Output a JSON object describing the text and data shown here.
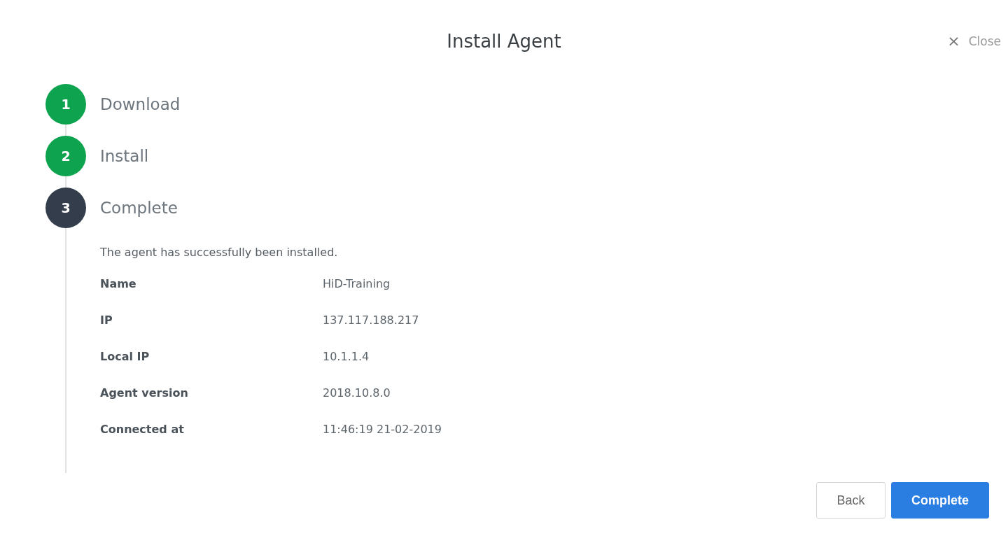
{
  "dialog": {
    "title": "Install Agent",
    "close": {
      "icon": "×",
      "label": "Close"
    }
  },
  "steps": [
    {
      "number": "1",
      "label": "Download",
      "completed": true,
      "selected": false
    },
    {
      "number": "2",
      "label": "Install",
      "completed": true,
      "selected": false
    },
    {
      "number": "3",
      "label": "Complete",
      "completed": false,
      "selected": true,
      "message": "The agent has successfully been installed.",
      "details": [
        {
          "label": "Name",
          "value": "HiD-Training"
        },
        {
          "label": "IP",
          "value": "137.117.188.217"
        },
        {
          "label": "Local IP",
          "value": "10.1.1.4"
        },
        {
          "label": "Agent version",
          "value": "2018.10.8.0"
        },
        {
          "label": "Connected at",
          "value": "11:46:19 21-02-2019"
        }
      ]
    }
  ],
  "buttons": [
    {
      "label": "Back",
      "kind": "secondary"
    },
    {
      "label": "Complete",
      "kind": "primary"
    }
  ]
}
